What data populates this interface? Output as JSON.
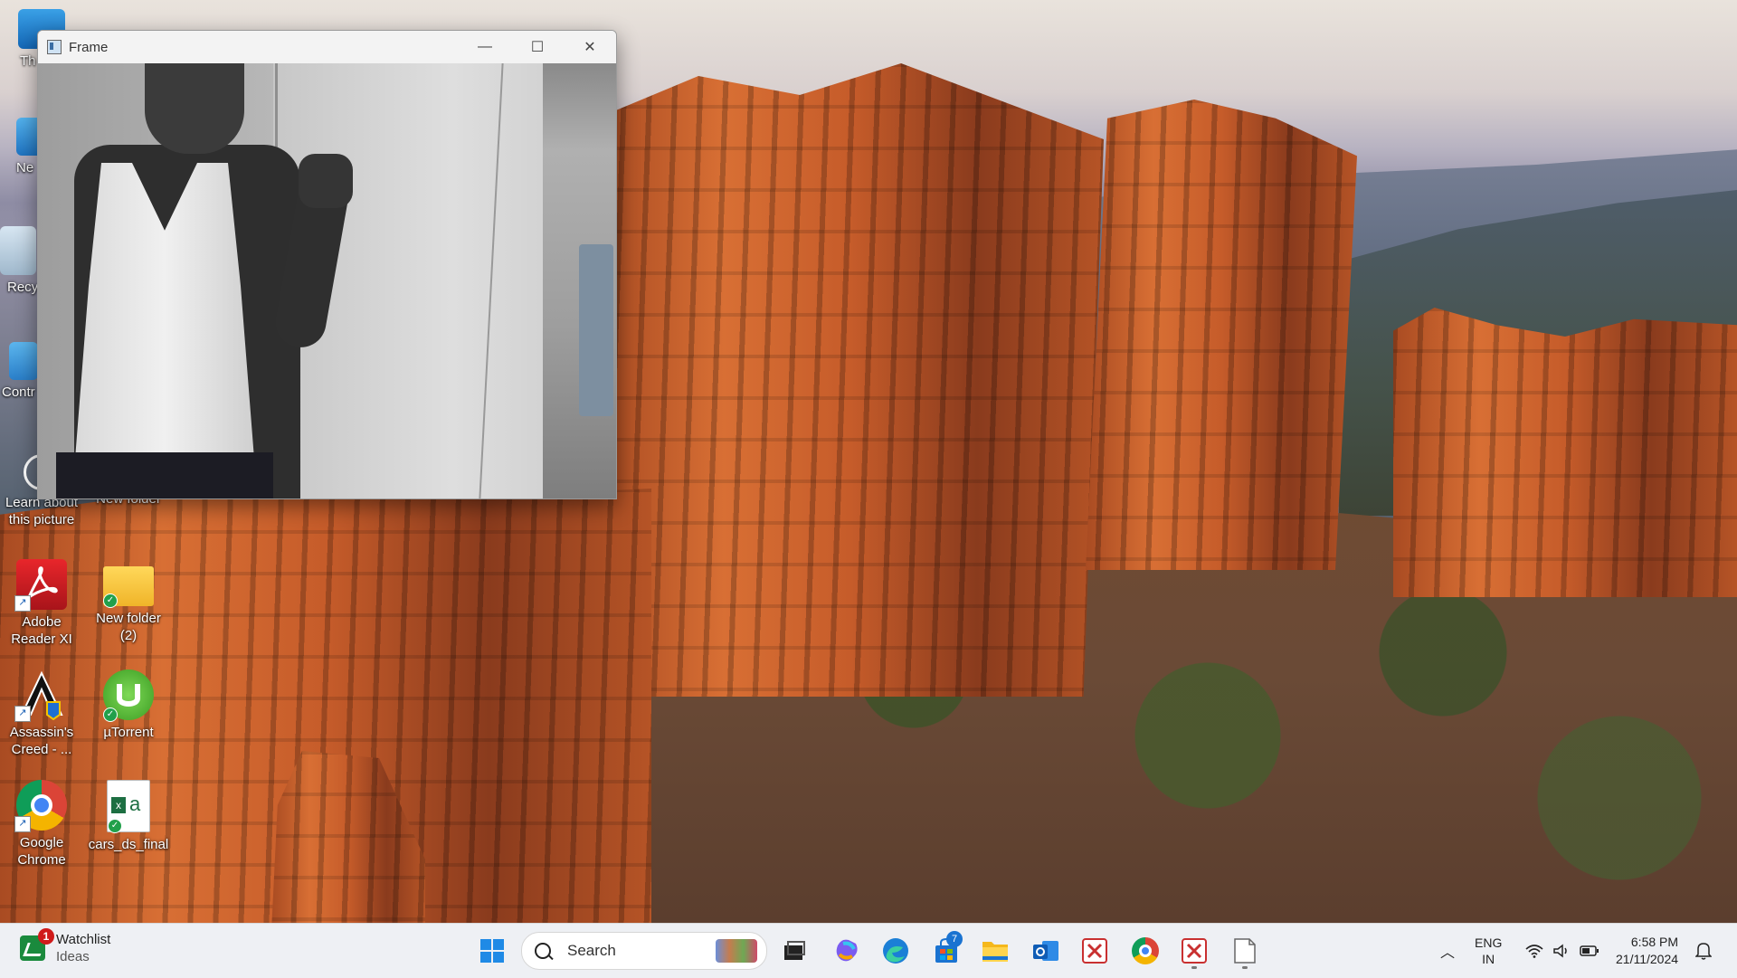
{
  "colors": {
    "taskbar_bg": "#eef0f4",
    "accent": "#0078d4",
    "notification_badge": "#d01b1b"
  },
  "window": {
    "title": "Frame",
    "minimize_glyph": "—",
    "maximize_glyph": "☐",
    "close_glyph": "✕"
  },
  "desktop": {
    "icons": [
      {
        "label": "Learn about this picture",
        "icon": "camera-info-icon"
      },
      {
        "label": "New folder",
        "icon": "folder-icon"
      },
      {
        "label": "Adobe Reader XI",
        "icon": "adobe-reader-icon"
      },
      {
        "label": "New folder (2)",
        "icon": "folder-icon"
      },
      {
        "label": "Assassin's Creed - ...",
        "icon": "assassins-creed-icon"
      },
      {
        "label": "µTorrent",
        "icon": "utorrent-icon"
      },
      {
        "label": "Google Chrome",
        "icon": "chrome-icon"
      },
      {
        "label": "cars_ds_final",
        "icon": "excel-file-icon"
      }
    ],
    "partial_icons": [
      {
        "label": "Th",
        "icon": "this-pc-icon"
      },
      {
        "label": "Ne",
        "icon": "network-icon"
      },
      {
        "label": "Recy",
        "icon": "recycle-bin-icon"
      },
      {
        "label": "Contr",
        "icon": "control-panel-icon"
      }
    ]
  },
  "taskbar": {
    "widget": {
      "title": "Watchlist",
      "subtitle": "Ideas",
      "badge": "1"
    },
    "search": {
      "label": "Search"
    },
    "pinned_apps": [
      {
        "name": "Start",
        "icon": "windows-start-icon"
      },
      {
        "name": "Task View",
        "icon": "task-view-icon"
      },
      {
        "name": "Copilot",
        "icon": "copilot-icon"
      },
      {
        "name": "Microsoft Edge",
        "icon": "edge-icon"
      },
      {
        "name": "Microsoft Store",
        "icon": "store-icon",
        "badge": "7"
      },
      {
        "name": "File Explorer",
        "icon": "file-explorer-icon"
      },
      {
        "name": "Outlook",
        "icon": "outlook-icon"
      },
      {
        "name": "Snipping Tool",
        "icon": "snipping-tool-icon"
      },
      {
        "name": "Google Chrome",
        "icon": "chrome-icon"
      },
      {
        "name": "Snipping Tool (open)",
        "icon": "snipping-tool-icon"
      },
      {
        "name": "Notepad (open)",
        "icon": "notepad-icon"
      }
    ],
    "tray": {
      "language_top": "ENG",
      "language_bottom": "IN",
      "time": "6:58 PM",
      "date": "21/11/2024"
    }
  }
}
